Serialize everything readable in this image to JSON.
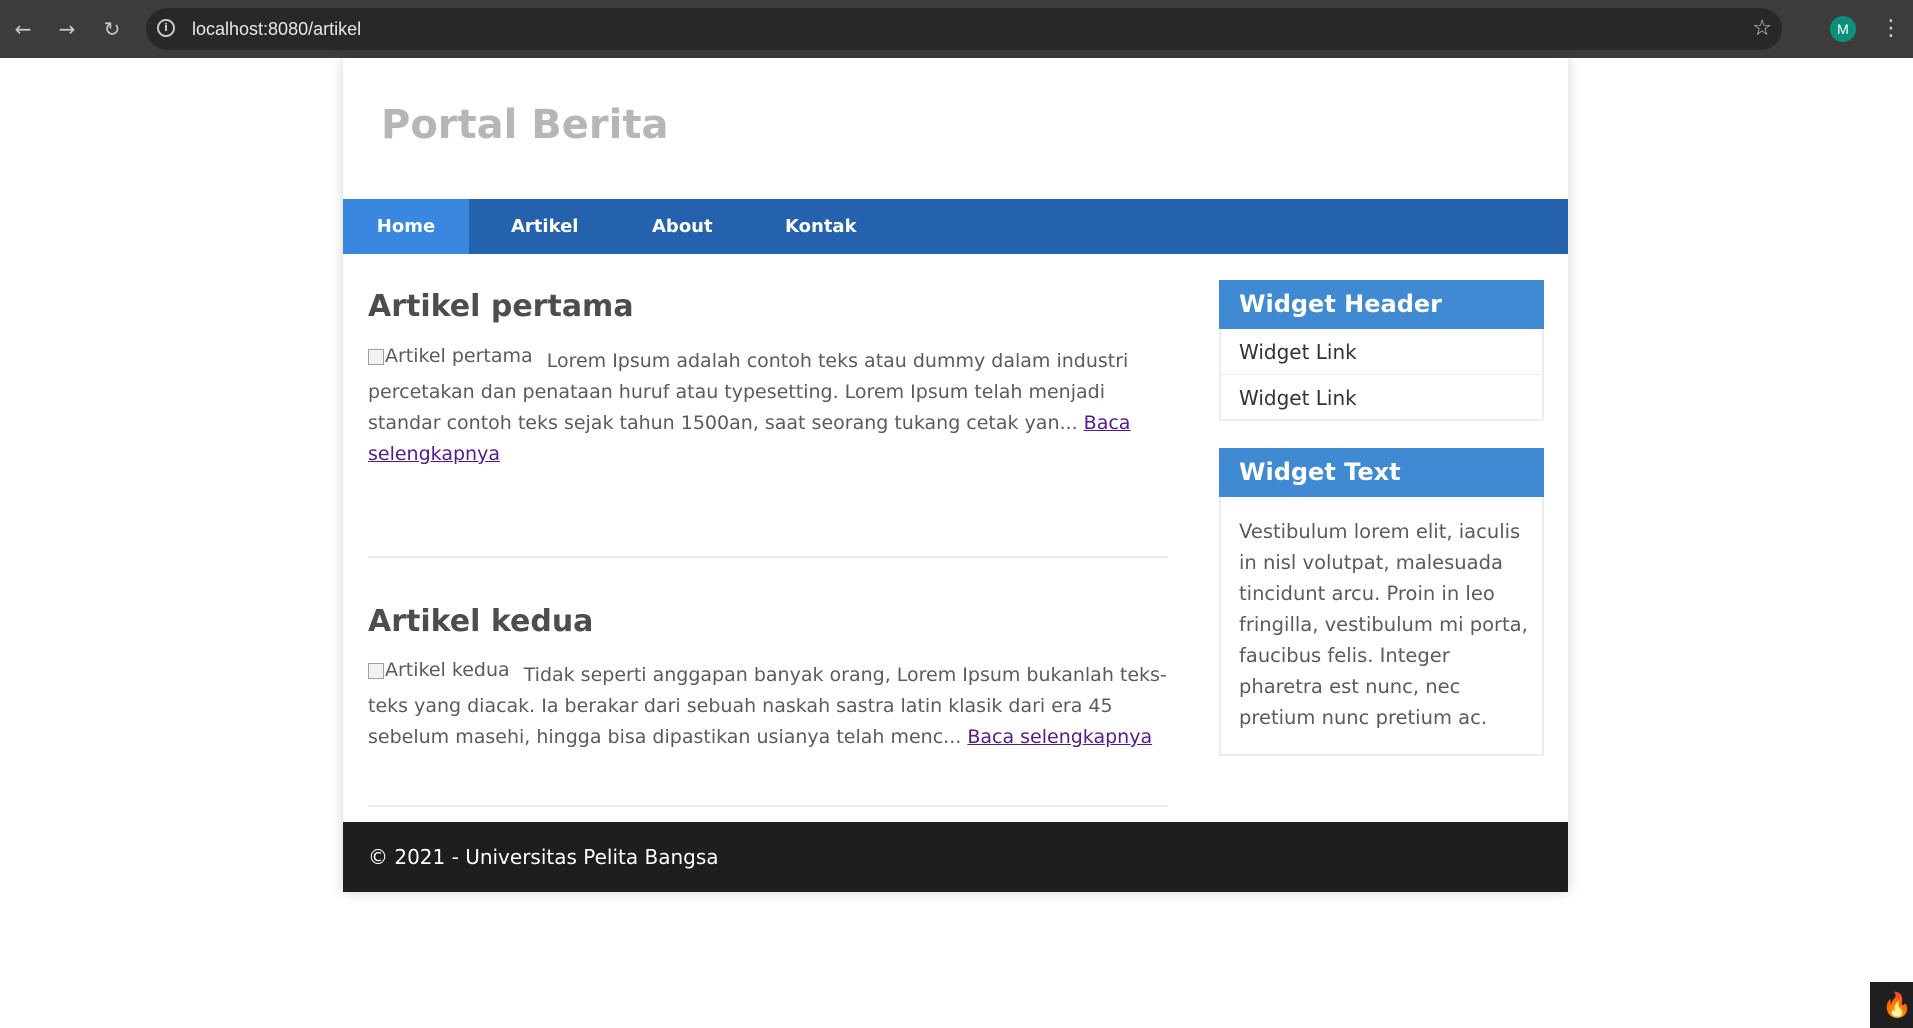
{
  "browser": {
    "url": "localhost:8080/artikel",
    "avatar_letter": "M",
    "icons": {
      "back": "arrow-left",
      "forward": "arrow-right",
      "reload": "reload",
      "info": "info",
      "bookmark": "star",
      "menu": "kebab"
    }
  },
  "site": {
    "title": "Portal Berita"
  },
  "nav": {
    "items": [
      {
        "label": "Home",
        "active": true
      },
      {
        "label": "Artikel",
        "active": false
      },
      {
        "label": "About",
        "active": false
      },
      {
        "label": "Kontak",
        "active": false
      }
    ]
  },
  "articles": [
    {
      "title": "Artikel pertama",
      "image_alt": "Artikel pertama",
      "excerpt": "Lorem Ipsum adalah contoh teks atau dummy dalam industri percetakan dan penataan huruf atau typesetting. Lorem Ipsum telah menjadi standar contoh teks sejak tahun 1500an, saat seorang tukang cetak yan...",
      "read_more": "Baca selengkapnya"
    },
    {
      "title": "Artikel kedua",
      "image_alt": "Artikel kedua",
      "excerpt": "Tidak seperti anggapan banyak orang, Lorem Ipsum bukanlah teks-teks yang diacak. Ia berakar dari sebuah naskah sastra latin klasik dari era 45 sebelum masehi, hingga bisa dipastikan usianya telah menc...",
      "read_more": "Baca selengkapnya"
    }
  ],
  "sidebar": {
    "widget_header": {
      "title": "Widget Header",
      "links": [
        "Widget Link",
        "Widget Link"
      ]
    },
    "widget_text": {
      "title": "Widget Text",
      "text": "Vestibulum lorem elit, iaculis in nisl volutpat, malesuada tincidunt arcu. Proin in leo fringilla, vestibulum mi porta, faucibus felis. Integer pharetra est nunc, nec pretium nunc pretium ac."
    }
  },
  "footer": {
    "text": "© 2021 - Universitas Pelita Bangsa"
  },
  "colors": {
    "nav_bg": "#2462ad",
    "nav_active": "#3a87e0",
    "widget_header_bg": "#3f8ad3",
    "footer_bg": "#1e1e1e",
    "title_gray": "#b6b6b6",
    "link_visited": "#551a8b"
  }
}
